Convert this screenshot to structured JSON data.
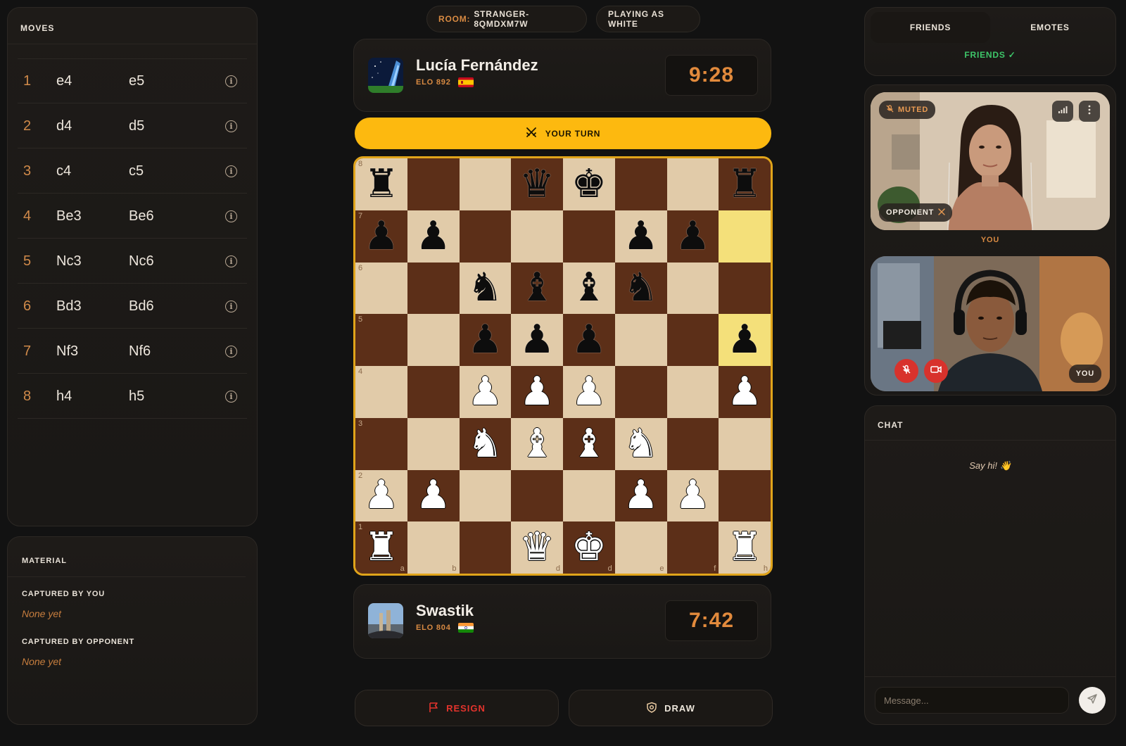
{
  "moves_panel": {
    "title": "MOVES",
    "moves": [
      {
        "num": "1",
        "white": "e4",
        "black": "e5"
      },
      {
        "num": "2",
        "white": "d4",
        "black": "d5"
      },
      {
        "num": "3",
        "white": "c4",
        "black": "c5"
      },
      {
        "num": "4",
        "white": "Be3",
        "black": "Be6"
      },
      {
        "num": "5",
        "white": "Nc3",
        "black": "Nc6"
      },
      {
        "num": "6",
        "white": "Bd3",
        "black": "Bd6"
      },
      {
        "num": "7",
        "white": "Nf3",
        "black": "Nf6"
      },
      {
        "num": "8",
        "white": "h4",
        "black": "h5"
      }
    ]
  },
  "material": {
    "title": "MATERIAL",
    "captured_by_you_label": "CAPTURED BY YOU",
    "captured_by_you_value": "None yet",
    "captured_by_opponent_label": "CAPTURED BY OPPONENT",
    "captured_by_opponent_value": "None yet"
  },
  "header": {
    "room_key": "ROOM:",
    "room_value": "STRANGER-8QMDXM7W",
    "playing_as": "PLAYING AS WHITE"
  },
  "opponent": {
    "name": "Lucía Fernández",
    "elo": "ELO 892",
    "flag": "spain-flag",
    "clock": "9:28"
  },
  "turn": {
    "label": "YOUR TURN",
    "icon": "crossed-swords-icon"
  },
  "board": {
    "ranks": [
      [
        "bR",
        "",
        "",
        "bQ",
        "bK",
        "",
        "",
        "bR"
      ],
      [
        "bP",
        "bP",
        "",
        "",
        "",
        "bP",
        "bP",
        ""
      ],
      [
        "",
        "",
        "bN",
        "bB",
        "bB",
        "bN",
        "",
        ""
      ],
      [
        "",
        "",
        "bP",
        "bP",
        "bP",
        "",
        "",
        "bP"
      ],
      [
        "",
        "",
        "wP",
        "wP",
        "wP",
        "",
        "",
        "wP"
      ],
      [
        "",
        "",
        "wN",
        "wB",
        "wB",
        "wN",
        "",
        ""
      ],
      [
        "wP",
        "wP",
        "",
        "",
        "",
        "wP",
        "wP",
        ""
      ],
      [
        "wR",
        "",
        "",
        "wQ",
        "wK",
        "",
        "",
        "wR"
      ]
    ],
    "rank_labels": [
      "8",
      "7",
      "6",
      "5",
      "4",
      "3",
      "2",
      "1"
    ],
    "file_labels": [
      "a",
      "b",
      "",
      "d",
      "d",
      "e",
      "f",
      "h"
    ],
    "highlighted": [
      [
        1,
        7
      ],
      [
        3,
        7
      ]
    ],
    "colors": {
      "light": "#e1cba9",
      "dark": "#5c2f18",
      "highlight": "#f4e07a",
      "border": "#e0a41a"
    }
  },
  "me": {
    "name": "Swastik",
    "elo": "ELO 804",
    "flag": "india-flag",
    "clock": "7:42"
  },
  "actions": {
    "resign": "RESIGN",
    "draw": "DRAW"
  },
  "social": {
    "tabs": [
      "FRIENDS",
      "EMOTES"
    ],
    "active_tab": "FRIENDS",
    "status": "FRIENDS ✓"
  },
  "video": {
    "muted_label": "MUTED",
    "opponent_label": "OPPONENT",
    "you_divider": "YOU",
    "you_label": "YOU"
  },
  "chat": {
    "title": "CHAT",
    "empty": "Say hi! 👋",
    "placeholder": "Message..."
  },
  "accent_colors": {
    "orange": "#d88a42",
    "yellow": "#fdb90f",
    "green": "#3ec76a",
    "red": "#e3332c"
  }
}
